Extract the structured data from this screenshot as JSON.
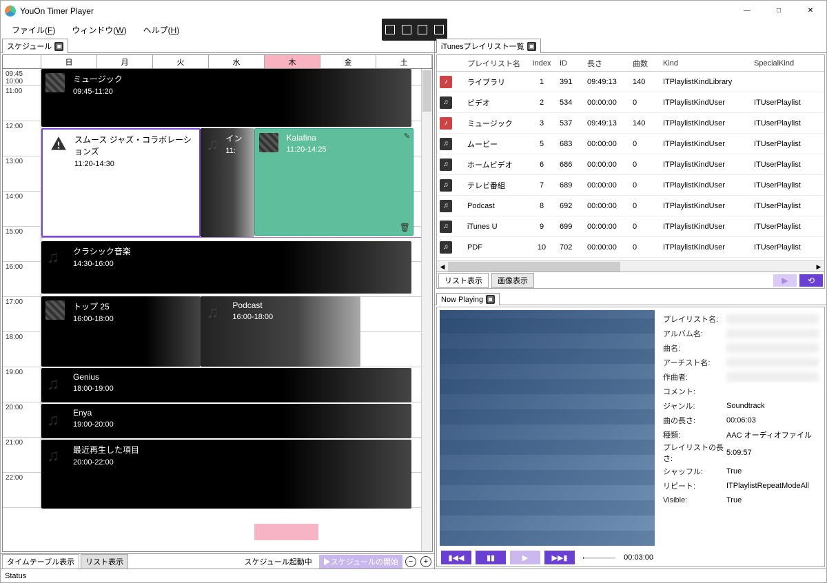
{
  "window": {
    "title": "YouOn Timer Player"
  },
  "menu": {
    "file": "ファイル(F)",
    "window": "ウィンドウ(W)",
    "help": "ヘルプ(H)"
  },
  "left": {
    "tab": "スケジュール",
    "days": [
      "日",
      "月",
      "火",
      "水",
      "木",
      "金",
      "土"
    ],
    "times": [
      "09:45\n10:00",
      "11:00",
      "12:00",
      "13:00",
      "14:00",
      "15:00",
      "16:00",
      "17:00",
      "18:00",
      "19:00",
      "20:00",
      "21:00",
      "22:00"
    ],
    "events": [
      {
        "title": "ミュージック",
        "range": "09:45-11:20"
      },
      {
        "title": "スムース ジャズ・コラボレーションズ",
        "range": "11:20-14:30"
      },
      {
        "title": "イン",
        "range": "11:"
      },
      {
        "title": "Kalafina",
        "range": "11:20-14:25"
      },
      {
        "title": "クラシック音楽",
        "range": "14:30-16:00"
      },
      {
        "title": "トップ 25",
        "range": "16:00-18:00"
      },
      {
        "title": "Podcast",
        "range": "16:00-18:00"
      },
      {
        "title": "Genius",
        "range": "18:00-19:00"
      },
      {
        "title": "Enya",
        "range": "19:00-20:00"
      },
      {
        "title": "最近再生した項目",
        "range": "20:00-22:00"
      }
    ],
    "footer": {
      "timetable": "タイムテーブル表示",
      "list": "リスト表示",
      "status": "スケジュール起動中",
      "start": "▶スケジュールの開始"
    }
  },
  "right": {
    "tab": "iTunesプレイリスト一覧",
    "cols": [
      "",
      "プレイリスト名",
      "Index",
      "ID",
      "長さ",
      "曲数",
      "Kind",
      "SpecialKind"
    ],
    "rows": [
      {
        "icon": "red",
        "name": "ライブラリ",
        "idx": "1",
        "id": "391",
        "len": "09:49:13",
        "cnt": "140",
        "kind": "ITPlaylistKindLibrary",
        "sk": ""
      },
      {
        "icon": "n",
        "name": "ビデオ",
        "idx": "2",
        "id": "534",
        "len": "00:00:00",
        "cnt": "0",
        "kind": "ITPlaylistKindUser",
        "sk": "ITUserPlaylist"
      },
      {
        "icon": "red",
        "name": "ミュージック",
        "idx": "3",
        "id": "537",
        "len": "09:49:13",
        "cnt": "140",
        "kind": "ITPlaylistKindUser",
        "sk": "ITUserPlaylist"
      },
      {
        "icon": "n",
        "name": "ムービー",
        "idx": "5",
        "id": "683",
        "len": "00:00:00",
        "cnt": "0",
        "kind": "ITPlaylistKindUser",
        "sk": "ITUserPlaylist"
      },
      {
        "icon": "n",
        "name": "ホームビデオ",
        "idx": "6",
        "id": "686",
        "len": "00:00:00",
        "cnt": "0",
        "kind": "ITPlaylistKindUser",
        "sk": "ITUserPlaylist"
      },
      {
        "icon": "n",
        "name": "テレビ番組",
        "idx": "7",
        "id": "689",
        "len": "00:00:00",
        "cnt": "0",
        "kind": "ITPlaylistKindUser",
        "sk": "ITUserPlaylist"
      },
      {
        "icon": "n",
        "name": "Podcast",
        "idx": "8",
        "id": "692",
        "len": "00:00:00",
        "cnt": "0",
        "kind": "ITPlaylistKindUser",
        "sk": "ITUserPlaylist"
      },
      {
        "icon": "n",
        "name": "iTunes U",
        "idx": "9",
        "id": "699",
        "len": "00:00:00",
        "cnt": "0",
        "kind": "ITPlaylistKindUser",
        "sk": "ITUserPlaylist"
      },
      {
        "icon": "n",
        "name": "PDF",
        "idx": "10",
        "id": "702",
        "len": "00:00:00",
        "cnt": "0",
        "kind": "ITPlaylistKindUser",
        "sk": "ITUserPlaylist"
      }
    ],
    "viewbtns": {
      "list": "リスト表示",
      "image": "画像表示"
    }
  },
  "np": {
    "tab": "Now Playing",
    "time": "00:03:00",
    "meta": {
      "playlist_l": "プレイリスト名:",
      "playlist": "",
      "album_l": "アルバム名:",
      "album": "",
      "song_l": "曲名:",
      "song": "",
      "artist_l": "アーチスト名:",
      "artist": "",
      "composer_l": "作曲者:",
      "composer": "",
      "comment_l": "コメント:",
      "comment": "",
      "genre_l": "ジャンル:",
      "genre": "Soundtrack",
      "length_l": "曲の長さ:",
      "length": "00:06:03",
      "kind_l": "種類:",
      "kind": "AAC オーディオファイル",
      "pllength_l": "プレイリストの長さ:",
      "pllength": "5:09:57",
      "shuffle_l": "シャッフル:",
      "shuffle": "True",
      "repeat_l": "リピート:",
      "repeat": "ITPlaylistRepeatModeAll",
      "visible_l": "Visible:",
      "visible": "True"
    }
  },
  "status": "Status"
}
